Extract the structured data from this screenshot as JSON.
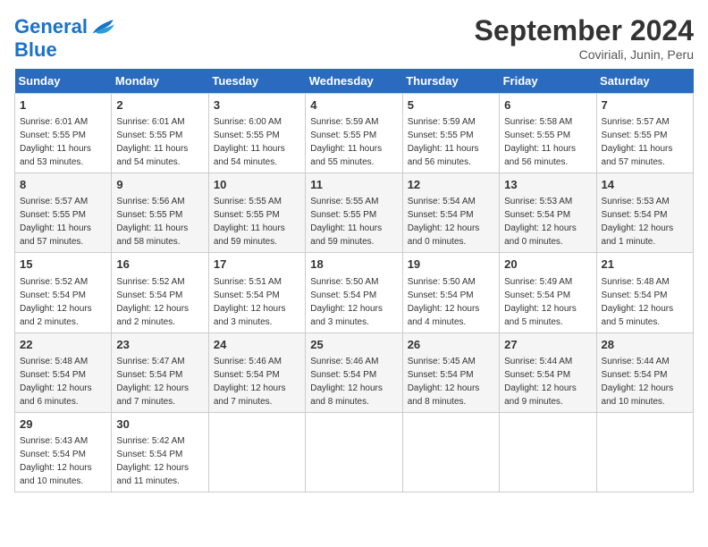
{
  "header": {
    "logo_line1": "General",
    "logo_line2": "Blue",
    "month": "September 2024",
    "location": "Coviriali, Junin, Peru"
  },
  "days_of_week": [
    "Sunday",
    "Monday",
    "Tuesday",
    "Wednesday",
    "Thursday",
    "Friday",
    "Saturday"
  ],
  "weeks": [
    [
      {
        "day": "1",
        "sunrise": "6:01 AM",
        "sunset": "5:55 PM",
        "daylight": "11 hours and 53 minutes."
      },
      {
        "day": "2",
        "sunrise": "6:01 AM",
        "sunset": "5:55 PM",
        "daylight": "11 hours and 54 minutes."
      },
      {
        "day": "3",
        "sunrise": "6:00 AM",
        "sunset": "5:55 PM",
        "daylight": "11 hours and 54 minutes."
      },
      {
        "day": "4",
        "sunrise": "5:59 AM",
        "sunset": "5:55 PM",
        "daylight": "11 hours and 55 minutes."
      },
      {
        "day": "5",
        "sunrise": "5:59 AM",
        "sunset": "5:55 PM",
        "daylight": "11 hours and 56 minutes."
      },
      {
        "day": "6",
        "sunrise": "5:58 AM",
        "sunset": "5:55 PM",
        "daylight": "11 hours and 56 minutes."
      },
      {
        "day": "7",
        "sunrise": "5:57 AM",
        "sunset": "5:55 PM",
        "daylight": "11 hours and 57 minutes."
      }
    ],
    [
      {
        "day": "8",
        "sunrise": "5:57 AM",
        "sunset": "5:55 PM",
        "daylight": "11 hours and 57 minutes."
      },
      {
        "day": "9",
        "sunrise": "5:56 AM",
        "sunset": "5:55 PM",
        "daylight": "11 hours and 58 minutes."
      },
      {
        "day": "10",
        "sunrise": "5:55 AM",
        "sunset": "5:55 PM",
        "daylight": "11 hours and 59 minutes."
      },
      {
        "day": "11",
        "sunrise": "5:55 AM",
        "sunset": "5:55 PM",
        "daylight": "11 hours and 59 minutes."
      },
      {
        "day": "12",
        "sunrise": "5:54 AM",
        "sunset": "5:54 PM",
        "daylight": "12 hours and 0 minutes."
      },
      {
        "day": "13",
        "sunrise": "5:53 AM",
        "sunset": "5:54 PM",
        "daylight": "12 hours and 0 minutes."
      },
      {
        "day": "14",
        "sunrise": "5:53 AM",
        "sunset": "5:54 PM",
        "daylight": "12 hours and 1 minute."
      }
    ],
    [
      {
        "day": "15",
        "sunrise": "5:52 AM",
        "sunset": "5:54 PM",
        "daylight": "12 hours and 2 minutes."
      },
      {
        "day": "16",
        "sunrise": "5:52 AM",
        "sunset": "5:54 PM",
        "daylight": "12 hours and 2 minutes."
      },
      {
        "day": "17",
        "sunrise": "5:51 AM",
        "sunset": "5:54 PM",
        "daylight": "12 hours and 3 minutes."
      },
      {
        "day": "18",
        "sunrise": "5:50 AM",
        "sunset": "5:54 PM",
        "daylight": "12 hours and 3 minutes."
      },
      {
        "day": "19",
        "sunrise": "5:50 AM",
        "sunset": "5:54 PM",
        "daylight": "12 hours and 4 minutes."
      },
      {
        "day": "20",
        "sunrise": "5:49 AM",
        "sunset": "5:54 PM",
        "daylight": "12 hours and 5 minutes."
      },
      {
        "day": "21",
        "sunrise": "5:48 AM",
        "sunset": "5:54 PM",
        "daylight": "12 hours and 5 minutes."
      }
    ],
    [
      {
        "day": "22",
        "sunrise": "5:48 AM",
        "sunset": "5:54 PM",
        "daylight": "12 hours and 6 minutes."
      },
      {
        "day": "23",
        "sunrise": "5:47 AM",
        "sunset": "5:54 PM",
        "daylight": "12 hours and 7 minutes."
      },
      {
        "day": "24",
        "sunrise": "5:46 AM",
        "sunset": "5:54 PM",
        "daylight": "12 hours and 7 minutes."
      },
      {
        "day": "25",
        "sunrise": "5:46 AM",
        "sunset": "5:54 PM",
        "daylight": "12 hours and 8 minutes."
      },
      {
        "day": "26",
        "sunrise": "5:45 AM",
        "sunset": "5:54 PM",
        "daylight": "12 hours and 8 minutes."
      },
      {
        "day": "27",
        "sunrise": "5:44 AM",
        "sunset": "5:54 PM",
        "daylight": "12 hours and 9 minutes."
      },
      {
        "day": "28",
        "sunrise": "5:44 AM",
        "sunset": "5:54 PM",
        "daylight": "12 hours and 10 minutes."
      }
    ],
    [
      {
        "day": "29",
        "sunrise": "5:43 AM",
        "sunset": "5:54 PM",
        "daylight": "12 hours and 10 minutes."
      },
      {
        "day": "30",
        "sunrise": "5:42 AM",
        "sunset": "5:54 PM",
        "daylight": "12 hours and 11 minutes."
      },
      null,
      null,
      null,
      null,
      null
    ]
  ]
}
